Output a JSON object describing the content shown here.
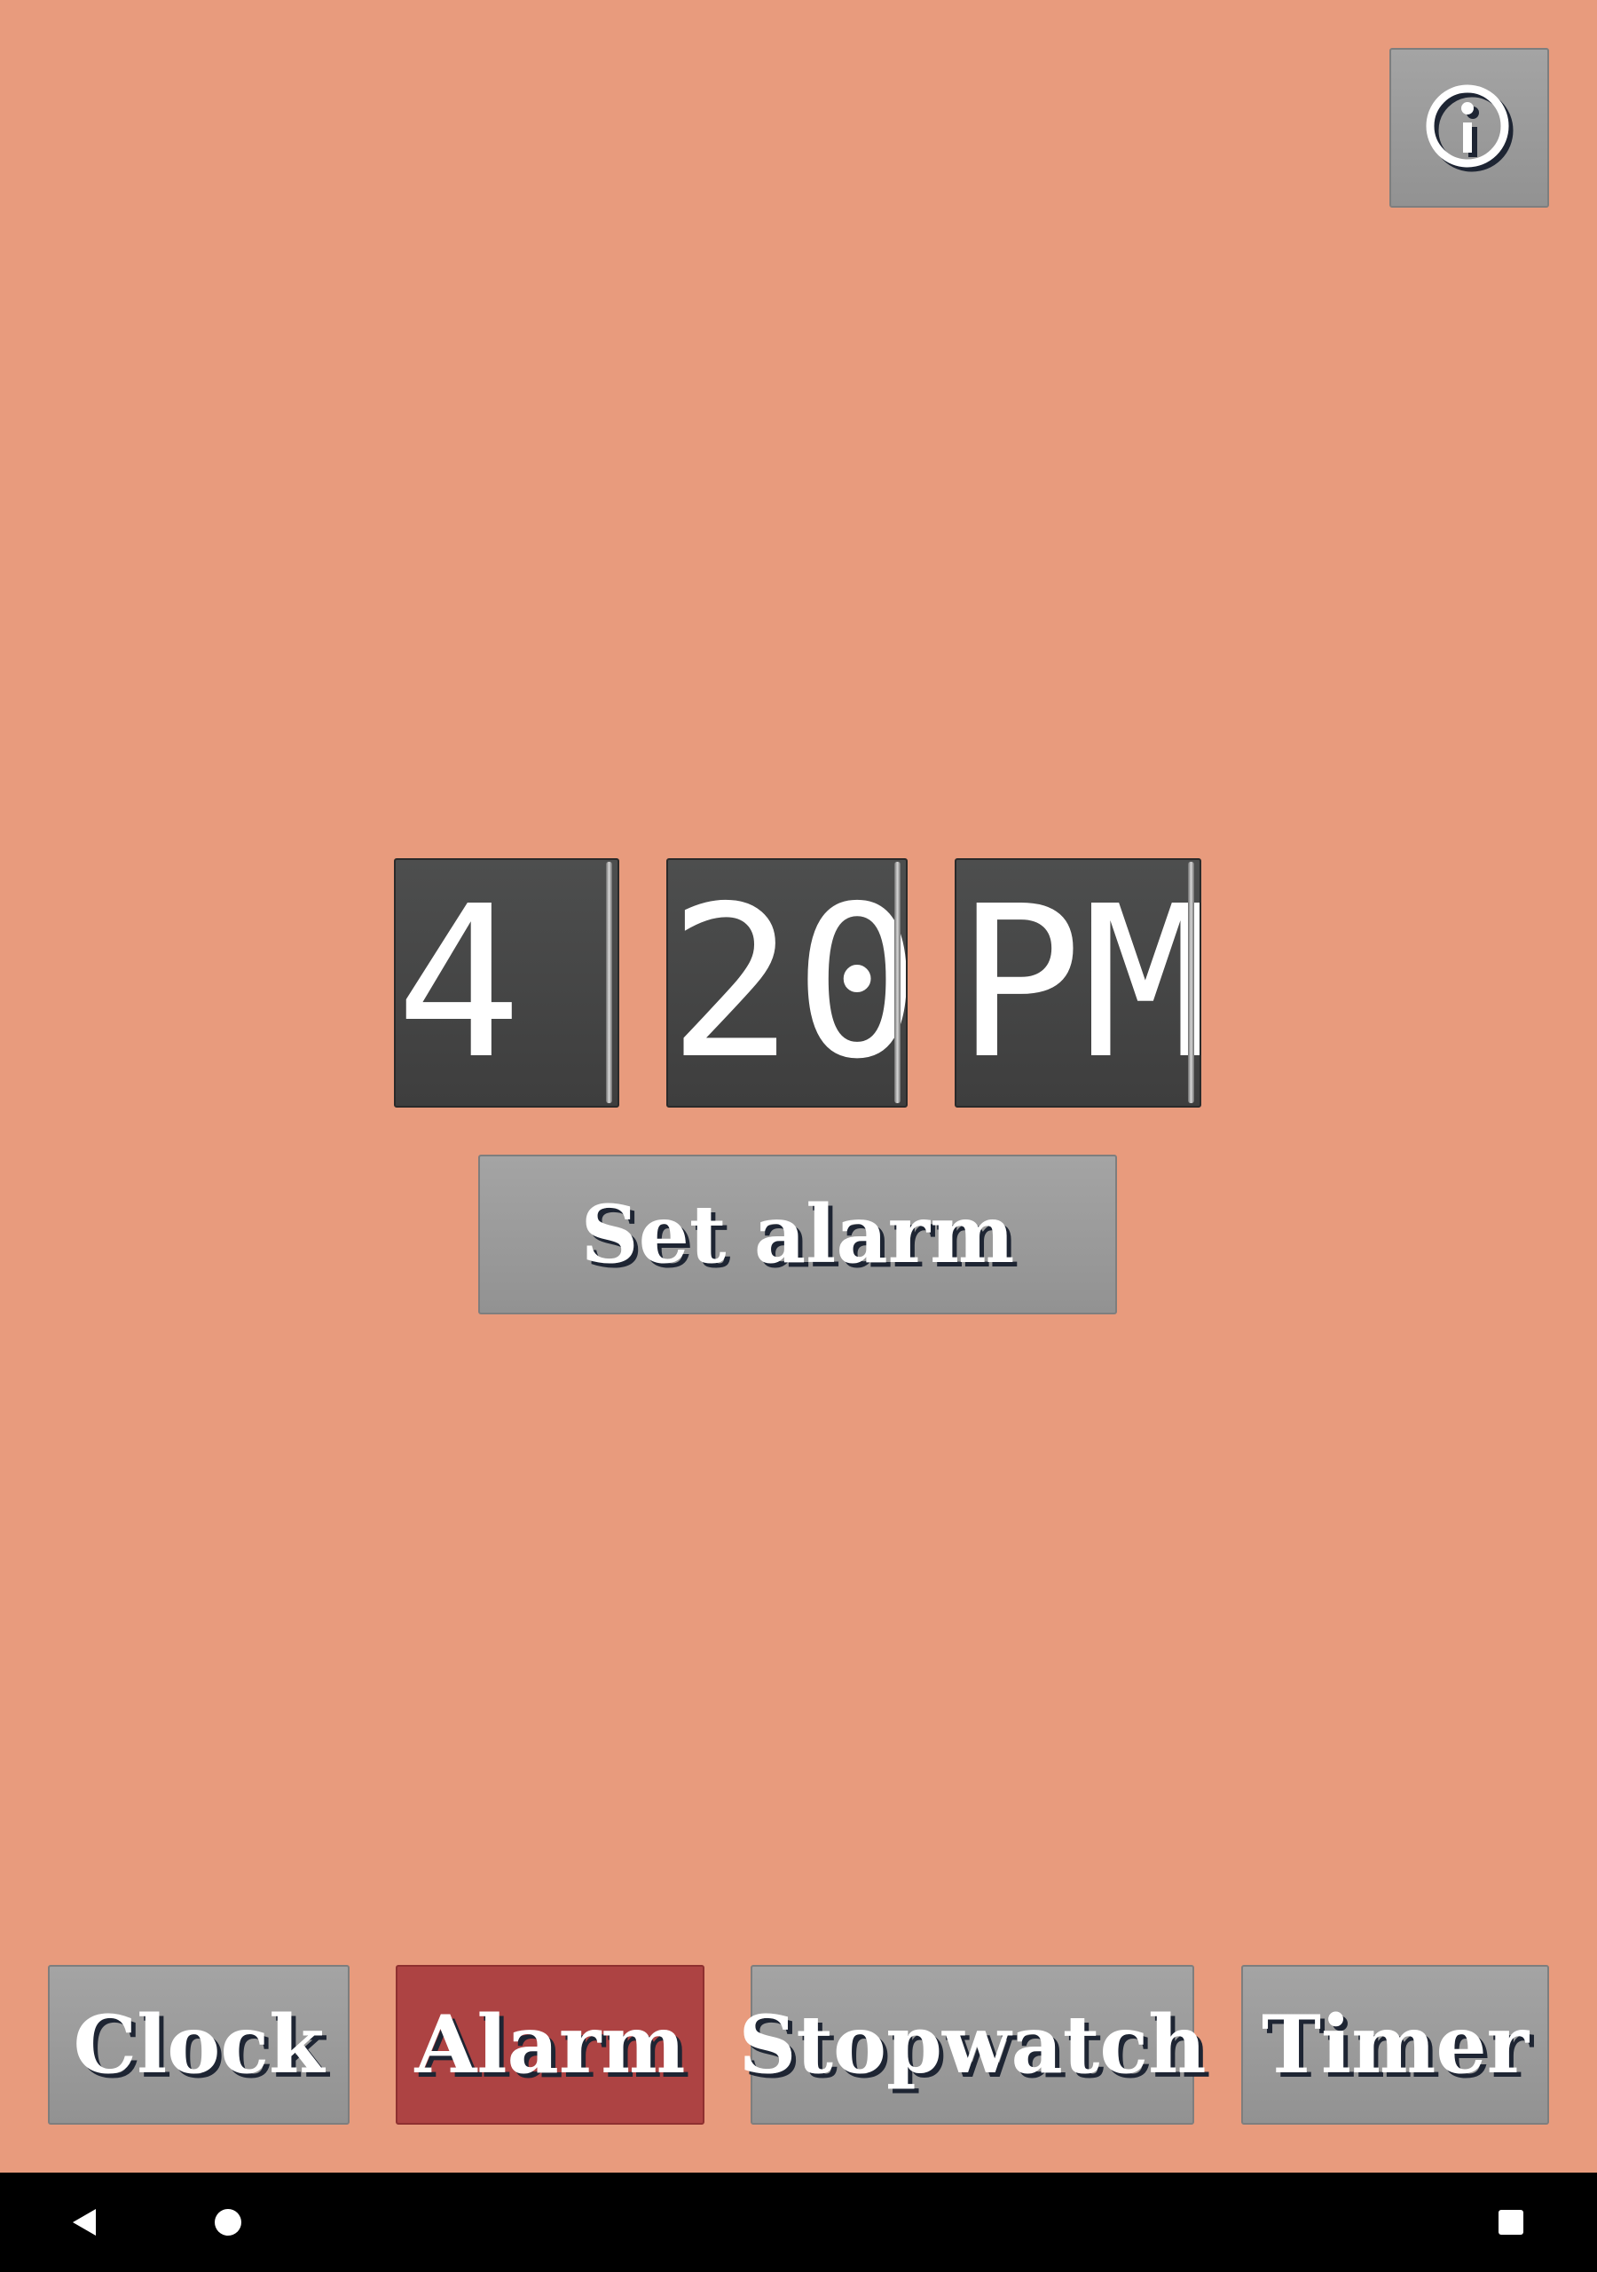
{
  "header": {
    "info_icon": "info-circle-icon"
  },
  "alarm": {
    "hour": "4",
    "minute": "20",
    "ampm": "PM",
    "set_label": "Set alarm"
  },
  "nav": {
    "items": [
      {
        "label": "Clock",
        "active": false
      },
      {
        "label": "Alarm",
        "active": true
      },
      {
        "label": "Stopwatch",
        "active": false
      },
      {
        "label": "Timer",
        "active": false
      }
    ],
    "active_color": "#ad4343"
  },
  "colors": {
    "background": "#e89b7d",
    "button": "#9b9b9b",
    "flip_card": "#474848"
  },
  "system_bar": {
    "back_icon": "back-triangle-icon",
    "home_icon": "home-circle-icon",
    "recents_icon": "recents-square-icon"
  }
}
